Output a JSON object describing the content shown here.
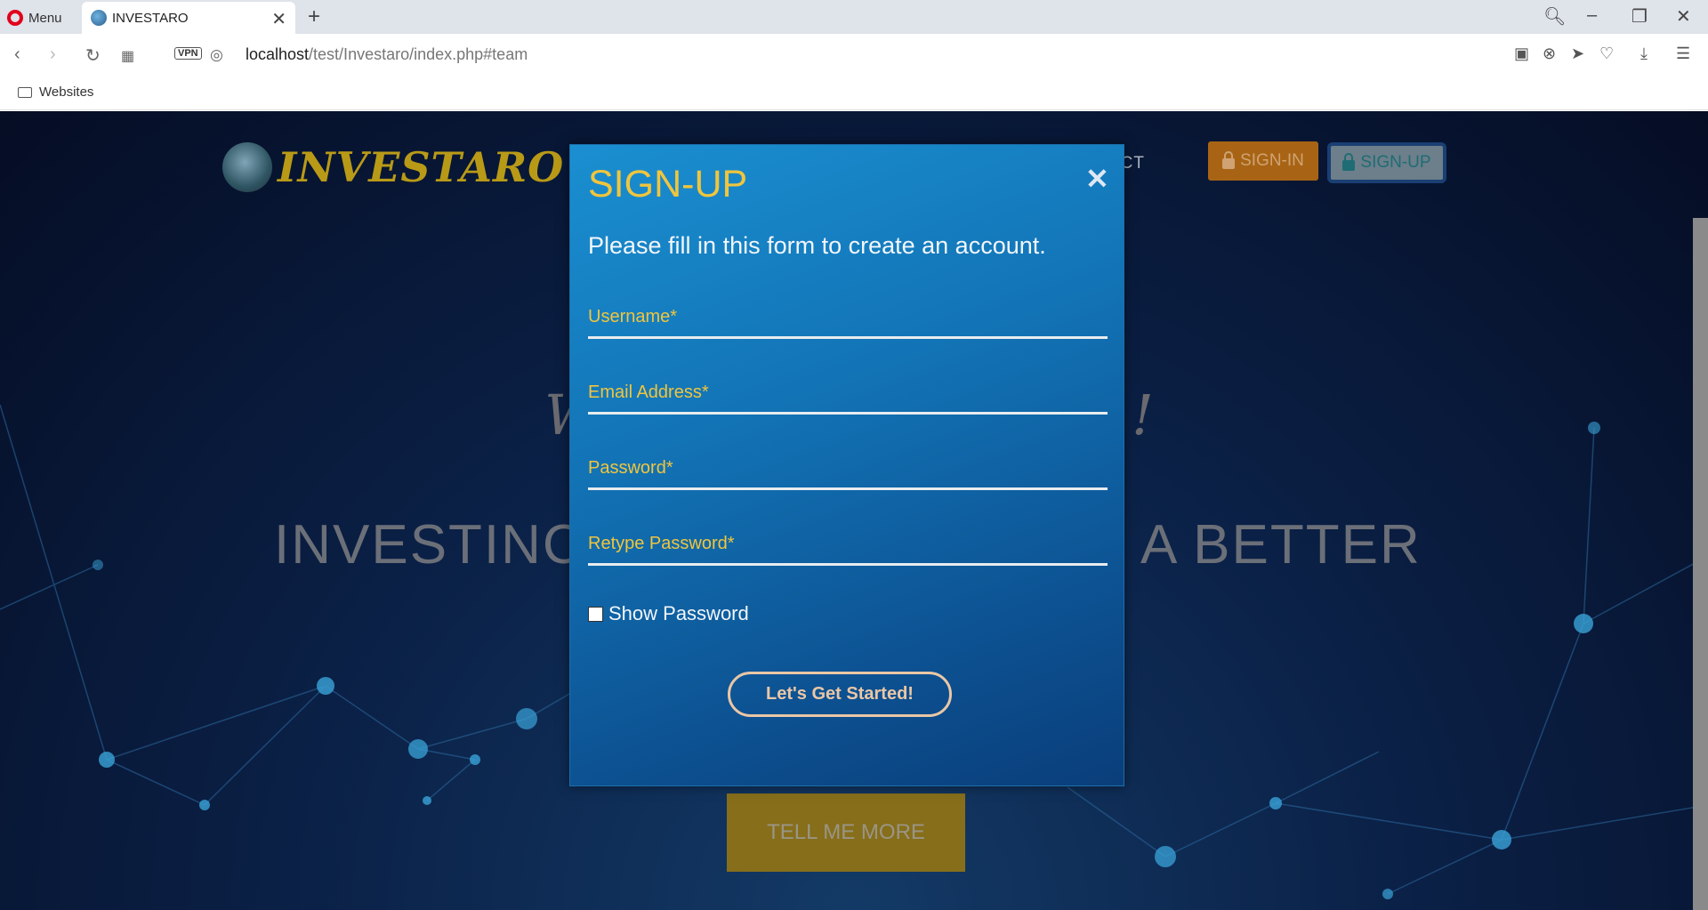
{
  "browser": {
    "menu_label": "Menu",
    "tab_title": "INVESTARO",
    "url_host": "localhost",
    "url_path": "/test/Investaro/index.php#team",
    "vpn_label": "VPN",
    "bookmark_folder": "Websites"
  },
  "site": {
    "logo_text": "INVESTARO",
    "nav_contact": "ACT",
    "signin_label": "SIGN-IN",
    "signup_label": "SIGN-UP",
    "hero_partial_left": "W",
    "hero_partial_right": "!",
    "tagline_left": "INVESTINC",
    "tagline_right": "A BETTER",
    "cta_label": "TELL ME MORE"
  },
  "modal": {
    "title": "SIGN-UP",
    "subtitle": "Please fill in this form to create an account.",
    "username_placeholder": "Username*",
    "email_placeholder": "Email Address*",
    "password_placeholder": "Password*",
    "retype_placeholder": "Retype Password*",
    "show_password_label": "Show Password",
    "submit_label": "Let's Get Started!"
  },
  "colors": {
    "accent_yellow": "#f0c53d",
    "modal_blue": "#1273b5",
    "signin_orange": "#a86414"
  }
}
